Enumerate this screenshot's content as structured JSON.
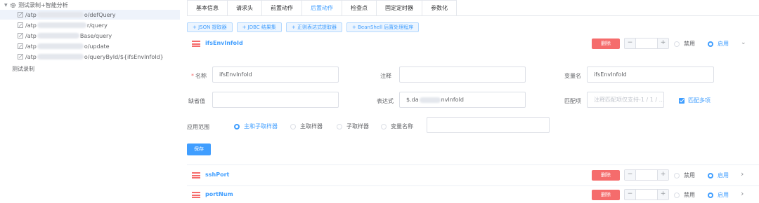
{
  "tree": {
    "root_label": "测试录制+智能分析",
    "children": [
      {
        "prefix": "/atp",
        "suffix": "o/defQuery"
      },
      {
        "prefix": "/atp",
        "suffix": "r/query"
      },
      {
        "prefix": "/atp",
        "suffix": "Base/query"
      },
      {
        "prefix": "/atp",
        "suffix": "o/update"
      },
      {
        "prefix": "/atp",
        "suffix": "o/queryById/${ifsEnvInfoId}"
      }
    ],
    "plain_label": "测试录制"
  },
  "tabs": [
    "基本信息",
    "请求头",
    "前置动作",
    "后置动作",
    "检查点",
    "固定定时器",
    "参数化"
  ],
  "active_tab": "后置动作",
  "extractor_buttons": [
    "+ JSON 提取器",
    "+ JDBC 结果集",
    "+ 正则表达式提取器",
    "+ BeanShell 后置处理程序"
  ],
  "processors": [
    {
      "name": "ifsEnvInfoId",
      "delete_label": "删除",
      "disable_label": "禁用",
      "enable_label": "启用",
      "state": "enabled",
      "chevron": "⌄"
    },
    {
      "name": "sshPort",
      "delete_label": "删除",
      "disable_label": "禁用",
      "enable_label": "启用",
      "state": "enabled",
      "chevron": "›"
    },
    {
      "name": "portNum",
      "delete_label": "删除",
      "disable_label": "禁用",
      "enable_label": "启用",
      "state": "enabled",
      "chevron": "›"
    }
  ],
  "form": {
    "name_label": "名称",
    "name_value": "ifsEnvInfoId",
    "comment_label": "注释",
    "comment_value": "",
    "variable_label": "变量名",
    "variable_value": "ifsEnvInfoId",
    "default_label": "缺省值",
    "default_value": "",
    "expr_label": "表达式",
    "expr_prefix": "$.da",
    "expr_suffix": "nvInfoId",
    "match_label": "匹配项",
    "match_placeholder": "注释匹配项仅支持-1 / 1 / ...",
    "match_multi_label": "匹配多项",
    "scope_label": "应用范围",
    "scope_options": [
      "主和子取样器",
      "主取样器",
      "子取样器",
      "变量名称"
    ],
    "scope_selected": "主和子取样器",
    "save_label": "保存"
  },
  "colors": {
    "accent": "#409eff",
    "danger": "#f56c6c",
    "selected_bg": "#eef3fb"
  }
}
